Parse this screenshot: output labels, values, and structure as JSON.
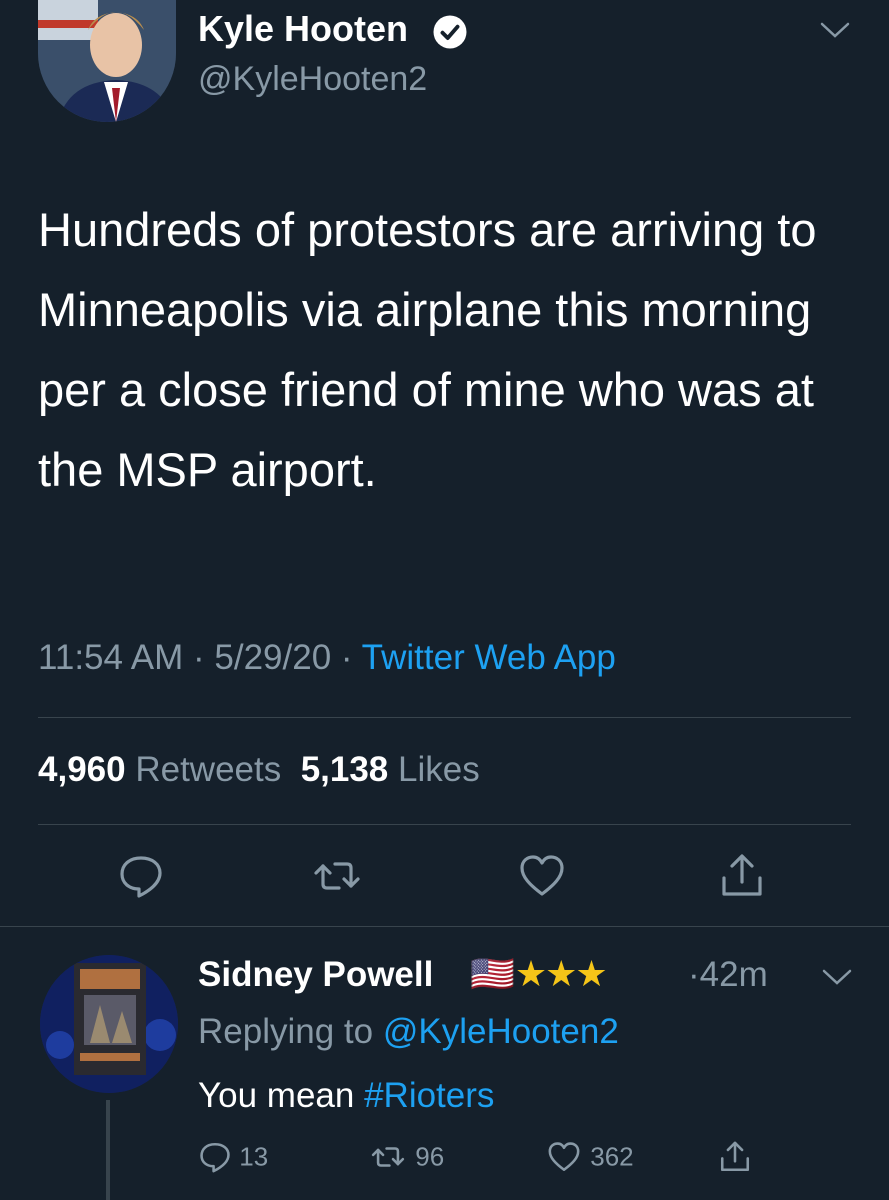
{
  "tweet": {
    "author_name": "Kyle Hooten",
    "author_handle": "@KyleHooten2",
    "text": "Hundreds of protestors are arriving to Minneapolis via airplane this morning per a close friend of mine who was at the MSP airport.",
    "time": "11:54 AM",
    "date": "5/29/20",
    "source": "Twitter Web App",
    "retweets_count": "4,960",
    "retweets_label": "Retweets",
    "likes_count": "5,138",
    "likes_label": "Likes"
  },
  "reply": {
    "author_name": "Sidney Powell",
    "flag": "🇺🇸",
    "stars": "★★★",
    "time": "42m",
    "replying_prefix": "Replying to",
    "replying_handle": "@KyleHooten2",
    "text_prefix": "You mean",
    "hashtag": "#Rioters",
    "replies_count": "13",
    "retweets_count": "96",
    "likes_count": "362"
  },
  "colors": {
    "background": "#15202b",
    "link": "#1da1f2",
    "secondary_text": "#8899a6",
    "star": "#f5c518"
  }
}
